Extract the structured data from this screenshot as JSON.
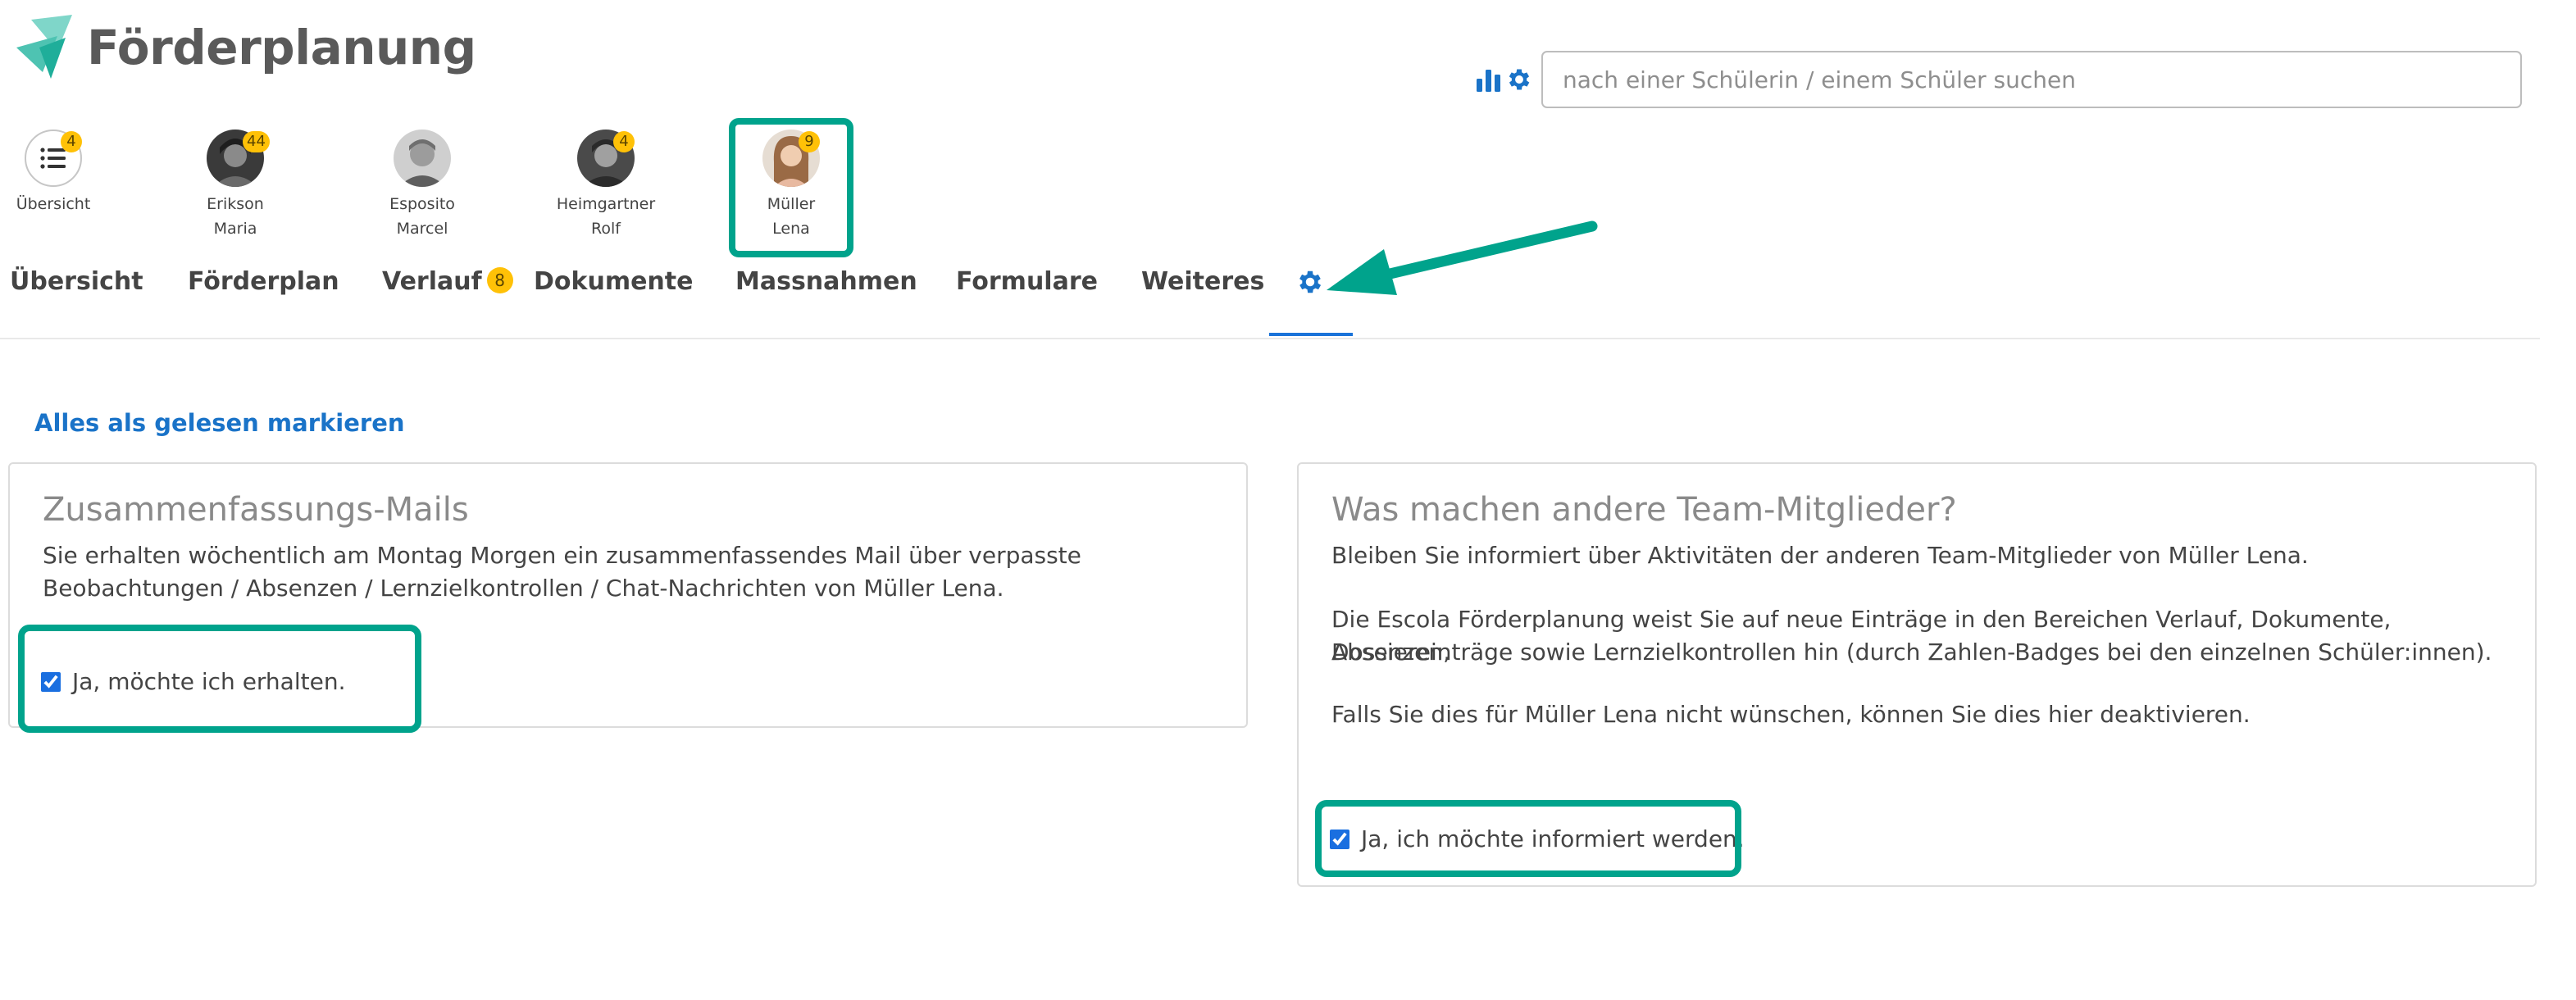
{
  "app": {
    "title": "Förderplanung"
  },
  "search": {
    "placeholder": "nach einer Schülerin / einem Schüler suchen"
  },
  "students": [
    {
      "name": "Übersicht",
      "first": "",
      "badge": "4"
    },
    {
      "name": "Erikson",
      "first": "Maria",
      "badge": "44"
    },
    {
      "name": "Esposito",
      "first": "Marcel",
      "badge": ""
    },
    {
      "name": "Heimgartner",
      "first": "Rolf",
      "badge": "4"
    },
    {
      "name": "Müller",
      "first": "Lena",
      "badge": "9"
    }
  ],
  "tabs": [
    {
      "label": "Übersicht",
      "badge": ""
    },
    {
      "label": "Förderplan",
      "badge": ""
    },
    {
      "label": "Verlauf",
      "badge": "8"
    },
    {
      "label": "Dokumente",
      "badge": ""
    },
    {
      "label": "Massnahmen",
      "badge": ""
    },
    {
      "label": "Formulare",
      "badge": ""
    },
    {
      "label": "Weiteres",
      "badge": ""
    }
  ],
  "mark_all_read": "Alles als gelesen markieren",
  "card_summary": {
    "title": "Zusammenfassungs-Mails",
    "text_line1": "Sie erhalten wöchentlich am Montag Morgen ein zusammenfassendes Mail über verpasste",
    "text_line2": "Beobachtungen / Absenzen / Lernzielkontrollen / Chat-Nachrichten von Müller Lena.",
    "checkbox_label": "Ja, möchte ich erhalten."
  },
  "card_team": {
    "title": "Was machen andere Team-Mitglieder?",
    "p1": "Bleiben Sie informiert über Aktivitäten der anderen Team-Mitglieder von Müller Lena.",
    "p2_line1": "Die Escola Förderplanung weist Sie auf neue Einträge in den Bereichen Verlauf, Dokumente, Absenzen,",
    "p2_line2": "Dossiereinträge sowie Lernzielkontrollen hin (durch Zahlen-Badges bei den einzelnen Schüler:innen).",
    "p3": "Falls Sie dies für Müller Lena nicht wünschen, können Sie dies hier deaktivieren.",
    "checkbox_label": "Ja, ich möchte informiert werden."
  },
  "colors": {
    "accent": "#1a73c8",
    "highlight": "#00a38c",
    "badge": "#ffc107"
  },
  "icons": [
    "app-logo-icon",
    "bar-chart-icon",
    "gear-icon",
    "list-icon",
    "arrow-annotation-icon"
  ]
}
